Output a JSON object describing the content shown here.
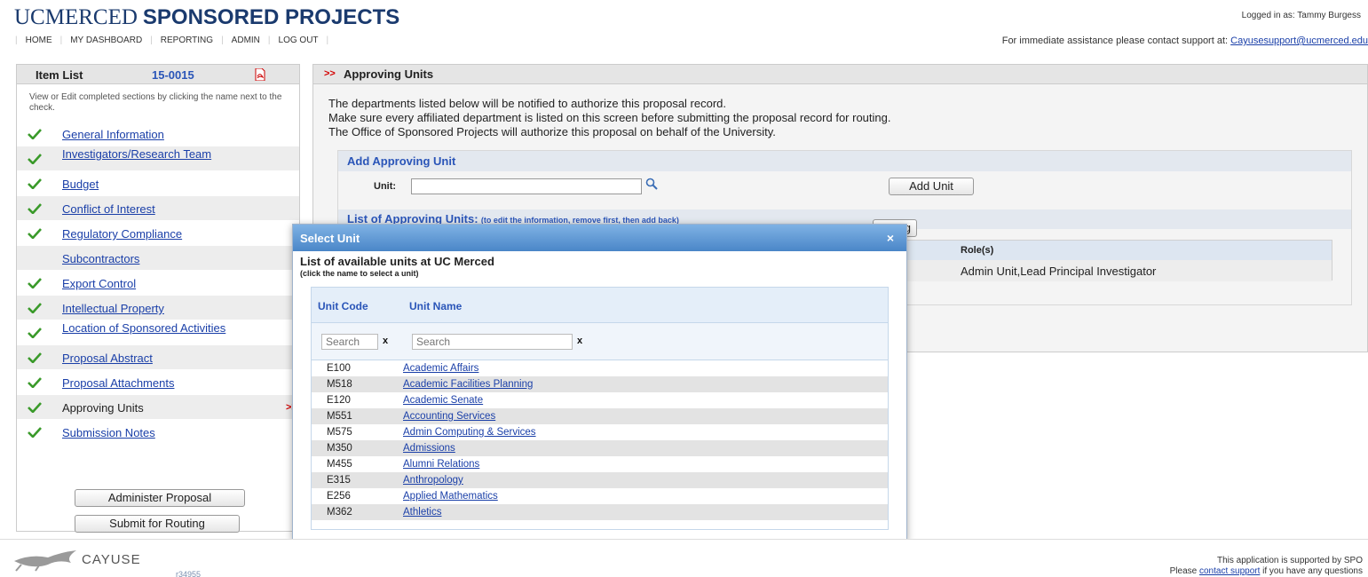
{
  "header": {
    "brand_uc": "UCMERCED",
    "brand_title": "SPONSORED PROJECTS",
    "logged_in": "Logged in as: Tammy Burgess",
    "nav": [
      "HOME",
      "MY DASHBOARD",
      "REPORTING",
      "ADMIN",
      "LOG OUT"
    ],
    "support_text": "For immediate assistance please contact support at:",
    "support_email": "Cayusesupport@ucmerced.edu"
  },
  "sidebar": {
    "title": "Item List",
    "proposal_number": "15-0015",
    "description": "View or Edit completed sections by clicking the name next to the check.",
    "items": [
      {
        "label": "General Information",
        "checked": true,
        "link": true
      },
      {
        "label": "Investigators/Research Team",
        "checked": true,
        "link": true
      },
      {
        "label": "Budget",
        "checked": true,
        "link": true
      },
      {
        "label": "Conflict of Interest",
        "checked": true,
        "link": true
      },
      {
        "label": "Regulatory Compliance",
        "checked": true,
        "link": true
      },
      {
        "label": "Subcontractors",
        "checked": false,
        "link": true
      },
      {
        "label": "Export Control",
        "checked": true,
        "link": true
      },
      {
        "label": "Intellectual Property",
        "checked": true,
        "link": true
      },
      {
        "label": "Location of Sponsored Activities",
        "checked": true,
        "link": true
      },
      {
        "label": "Proposal Abstract",
        "checked": true,
        "link": true
      },
      {
        "label": "Proposal Attachments",
        "checked": true,
        "link": true
      },
      {
        "label": "Approving Units",
        "checked": true,
        "link": false,
        "current": true
      },
      {
        "label": "Submission Notes",
        "checked": true,
        "link": true
      }
    ],
    "current_marker": ">>",
    "administer_button": "Administer Proposal",
    "submit_button": "Submit for Routing"
  },
  "main": {
    "marker": ">>",
    "title": "Approving Units",
    "intro": [
      "The departments listed below will be notified to authorize this proposal record.",
      "Make sure every affiliated department is listed on this screen before submitting the proposal record for routing.",
      "The Office of Sponsored Projects will authorize this proposal on behalf of the University."
    ],
    "add_title": "Add Approving Unit",
    "unit_label": "Unit:",
    "unit_value": "",
    "add_button": "Add Unit",
    "list_title": "List of Approving Units:",
    "list_note": "(to edit the information, remove first, then add back)",
    "roles_header": "Role(s)",
    "roles_value": "Admin Unit,Lead Principal Investigator",
    "partial_button_text": "g"
  },
  "modal": {
    "title": "Select Unit",
    "close": "×",
    "heading": "List of available units at UC Merced",
    "subheading": "(click the name to select a unit)",
    "col_code": "Unit Code",
    "col_name": "Unit Name",
    "filter_placeholder": "Search",
    "filter_clear": "x",
    "units": [
      {
        "code": "E100",
        "name": "Academic Affairs"
      },
      {
        "code": "M518",
        "name": "Academic Facilities Planning"
      },
      {
        "code": "E120",
        "name": "Academic Senate"
      },
      {
        "code": "M551",
        "name": "Accounting Services"
      },
      {
        "code": "M575",
        "name": "Admin Computing & Services"
      },
      {
        "code": "M350",
        "name": "Admissions"
      },
      {
        "code": "M455",
        "name": "Alumni Relations"
      },
      {
        "code": "E315",
        "name": "Anthropology"
      },
      {
        "code": "E256",
        "name": "Applied Mathematics"
      },
      {
        "code": "M362",
        "name": "Athletics"
      }
    ]
  },
  "footer": {
    "logo_text": "CAYUSE",
    "revision": "r34955",
    "line1": "This application is supported by SPO",
    "line2_pre": "Please",
    "line2_link": "contact support",
    "line2_post": "if you have any questions"
  },
  "colors": {
    "brand": "#1a3a6e",
    "link": "#1a3fa8",
    "accent_red": "#d40000",
    "check_green": "#3a9a2a",
    "modal_bar": "#4a86c8"
  },
  "icons": {
    "pdf": "pdf-icon",
    "check": "checkmark-icon",
    "search": "magnifier-icon",
    "close": "close-icon"
  }
}
